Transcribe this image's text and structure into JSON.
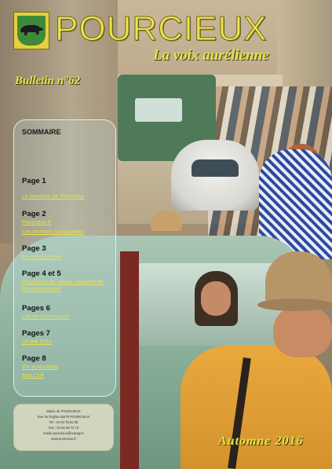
{
  "masthead": {
    "title": "POURCIEUX",
    "subtitle": "La voix aurélienne",
    "bulletin": "Bulletin n°62"
  },
  "sommaire": {
    "title": "SOMMAIRE",
    "entries": [
      {
        "page": "Page 1",
        "items": [
          "Le bouchon de Pourcieux"
        ]
      },
      {
        "page": "Page 2",
        "items": [
          "Pourcieux.fr",
          "Les archives municipales"
        ]
      },
      {
        "page": "Page 3",
        "items": [
          "Le mot du maire"
        ]
      },
      {
        "page": "Page 4 et 5",
        "items": [
          "Pourcieux, un village soucieux de l'environnement"
        ]
      },
      {
        "page": "Pages 6",
        "items": [
          "L'école communale"
        ]
      },
      {
        "page": "Pages 7",
        "items": [
          "Un été 2016"
        ]
      },
      {
        "page": "Page 8",
        "items": [
          "Vie associative",
          "Etat Civil"
        ]
      }
    ]
  },
  "contact": {
    "lines": [
      "Mairie de POURCIEUX",
      "Rue de l'Eglise 83470 POURCIEUX",
      "Tel : 04 94 78 02 05",
      "Fax : 04 94 59 73 73",
      "mairie.pourcieux@orange.fr",
      "www.pourcieux.fr"
    ]
  },
  "season": "Automne 2016",
  "colors": {
    "title_yellow": "#f4e04a",
    "link_yellow": "#e6e24a",
    "logo_green": "#3f8a3a"
  }
}
